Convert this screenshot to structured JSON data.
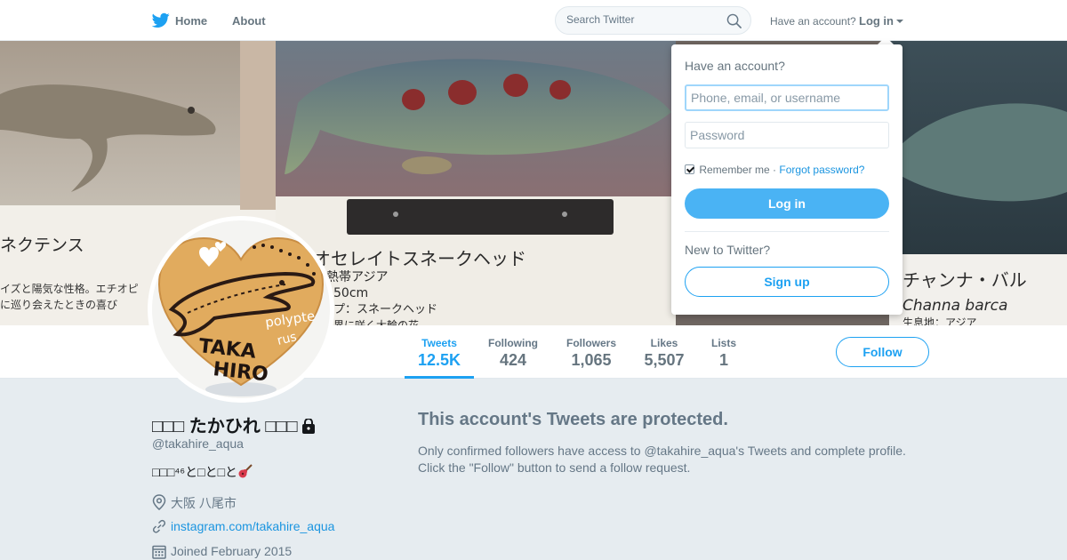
{
  "nav": {
    "home_label": "Home",
    "about_label": "About",
    "search_placeholder": "Search Twitter",
    "have_account": "Have an account?",
    "login_label": "Log in"
  },
  "banner": {
    "texts": {
      "left_species": "ネクテンス",
      "left_desc_1": "イズと陽気な性格。エチオピ",
      "left_desc_2": "に巡り会えたときの喜び",
      "center_name": "オセレイトスネークヘッド",
      "center_region": "熱帯アジア",
      "center_size": "50cm",
      "center_line_3": "プ：スネークヘッド",
      "center_line_4": "界に咲く大輪の花",
      "right_name": "チャンナ・バル",
      "right_latin": "Channa barca",
      "right_line_3": "生息地：アジア"
    }
  },
  "avatar": {
    "cookie_text_1": "TAKA",
    "cookie_text_2": "HIRO",
    "cookie_text_3": "polypte",
    "cookie_text_4": "rus"
  },
  "stats": [
    {
      "label": "Tweets",
      "value": "12.5K",
      "active": true
    },
    {
      "label": "Following",
      "value": "424"
    },
    {
      "label": "Followers",
      "value": "1,065"
    },
    {
      "label": "Likes",
      "value": "5,507"
    },
    {
      "label": "Lists",
      "value": "1"
    }
  ],
  "follow_label": "Follow",
  "profile": {
    "fullname": "□□□ たかひれ □□□",
    "handle": "@takahire_aqua",
    "bio": "□□□⁴⁶と□と□と",
    "location": "大阪 八尾市",
    "website": "instagram.com/takahire_aqua",
    "joined": "Joined February 2015"
  },
  "protected": {
    "title": "This account's Tweets are protected.",
    "text": "Only confirmed followers have access to @takahire_aqua's Tweets and complete profile. Click the \"Follow\" button to send a follow request."
  },
  "login_dropdown": {
    "title": "Have an account?",
    "username_placeholder": "Phone, email, or username",
    "password_placeholder": "Password",
    "remember_label": "Remember me",
    "separator": "·",
    "forgot_label": "Forgot password?",
    "login_button": "Log in",
    "new_label": "New to Twitter?",
    "signup_button": "Sign up"
  },
  "colors": {
    "accent": "#1da1f2",
    "link": "#1b95e0",
    "login_button": "#4ab3f4",
    "page_bg": "#e6ecf0"
  },
  "icons": {
    "logo": "twitter-bird-icon",
    "search": "search-icon",
    "caret": "caret-down-icon",
    "lock": "lock-icon",
    "bio": "guitar-icon",
    "location": "location-pin-icon",
    "link": "link-icon",
    "calendar": "calendar-icon"
  }
}
